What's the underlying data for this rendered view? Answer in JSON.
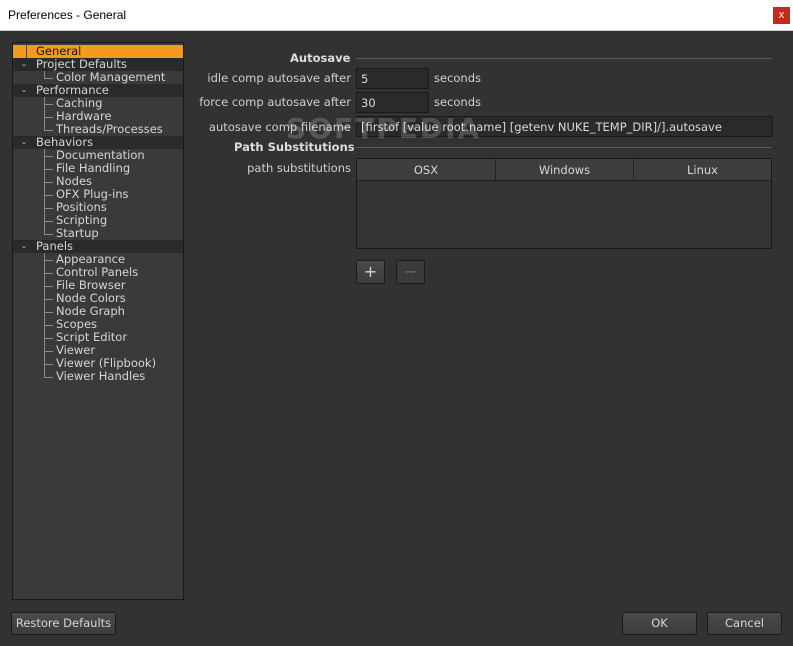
{
  "window": {
    "title": "Preferences - General",
    "close_glyph": "x"
  },
  "tree": {
    "items": [
      {
        "label": "General",
        "level": 0,
        "expander": "",
        "selected": true
      },
      {
        "label": "Project Defaults",
        "level": 0,
        "expander": "-"
      },
      {
        "label": "Color Management",
        "level": 1
      },
      {
        "label": "Performance",
        "level": 0,
        "expander": "-"
      },
      {
        "label": "Caching",
        "level": 1
      },
      {
        "label": "Hardware",
        "level": 1
      },
      {
        "label": "Threads/Processes",
        "level": 1
      },
      {
        "label": "Behaviors",
        "level": 0,
        "expander": "-"
      },
      {
        "label": "Documentation",
        "level": 1
      },
      {
        "label": "File Handling",
        "level": 1
      },
      {
        "label": "Nodes",
        "level": 1
      },
      {
        "label": "OFX Plug-ins",
        "level": 1
      },
      {
        "label": "Positions",
        "level": 1
      },
      {
        "label": "Scripting",
        "level": 1
      },
      {
        "label": "Startup",
        "level": 1
      },
      {
        "label": "Panels",
        "level": 0,
        "expander": "-"
      },
      {
        "label": "Appearance",
        "level": 1
      },
      {
        "label": "Control Panels",
        "level": 1
      },
      {
        "label": "File Browser",
        "level": 1
      },
      {
        "label": "Node Colors",
        "level": 1
      },
      {
        "label": "Node Graph",
        "level": 1
      },
      {
        "label": "Scopes",
        "level": 1
      },
      {
        "label": "Script Editor",
        "level": 1
      },
      {
        "label": "Viewer",
        "level": 1
      },
      {
        "label": "Viewer (Flipbook)",
        "level": 1
      },
      {
        "label": "Viewer Handles",
        "level": 1
      }
    ]
  },
  "autosave": {
    "section_title": "Autosave",
    "idle_label": "idle comp autosave after",
    "idle_value": "5",
    "idle_unit": "seconds",
    "force_label": "force comp autosave after",
    "force_value": "30",
    "force_unit": "seconds",
    "filename_label": "autosave comp filename",
    "filename_value": "[firstof [value root.name] [getenv NUKE_TEMP_DIR]/].autosave"
  },
  "path_subs": {
    "section_title": "Path Substitutions",
    "label": "path substitutions",
    "columns": [
      "OSX",
      "Windows",
      "Linux"
    ],
    "add_label": "+",
    "remove_label": "−"
  },
  "watermark": "SOFTPEDIA",
  "footer": {
    "restore_label": "Restore Defaults",
    "ok_label": "OK",
    "cancel_label": "Cancel"
  },
  "colors": {
    "selection": "#f39a1f",
    "background": "#323232",
    "close": "#c42b1c"
  }
}
